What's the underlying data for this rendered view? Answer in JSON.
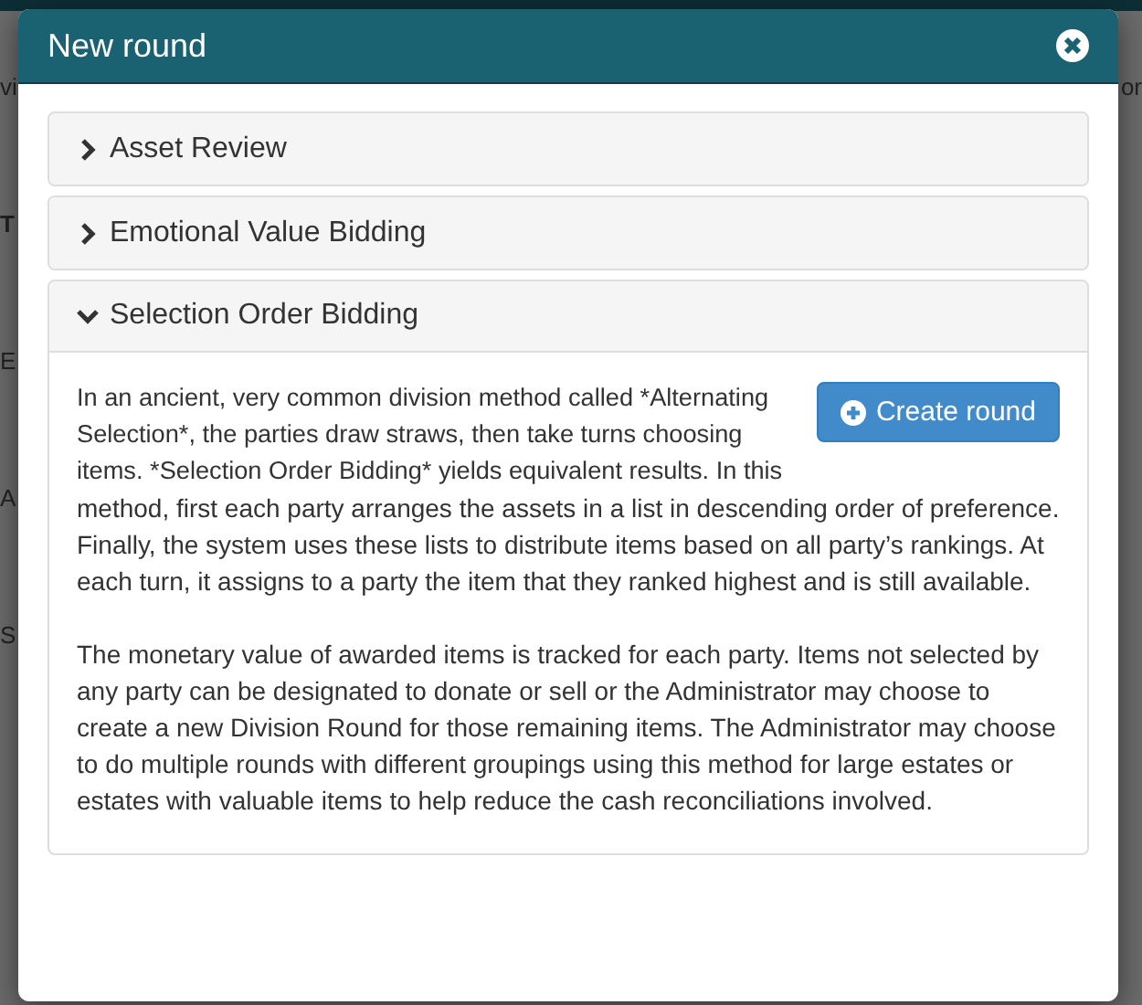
{
  "background": {
    "left_fragments": [
      {
        "text": "vi",
        "bold": false
      },
      {
        "text": "T",
        "bold": true
      },
      {
        "text": "E",
        "bold": false
      },
      {
        "text": "A",
        "bold": false
      },
      {
        "text": "S",
        "bold": false
      }
    ],
    "right_fragments": [
      {
        "text": "or",
        "bold": false
      }
    ]
  },
  "modal": {
    "title": "New round",
    "panels": [
      {
        "title": "Asset Review",
        "expanded": false
      },
      {
        "title": "Emotional Value Bidding",
        "expanded": false
      },
      {
        "title": "Selection Order Bidding",
        "expanded": true,
        "button": "Create round",
        "lead": "In an ancient, very common division method called *Alternating Selection*, the parties draw straws, then take turns choosing items. *Selection Order Bidding* yields equivalent results. In this",
        "paragraphs": [
          "method, first each party arranges the assets in a list in descending order of preference. Finally, the system uses these lists to distribute items based on all party’s rankings. At each turn, it assigns to a party the item that they ranked highest and is still available.",
          "The monetary value of awarded items is tracked for each party. Items not selected by any party can be designated to donate or sell or the Administrator may choose to create a new Division Round for those remaining items. The Administrator may choose to do multiple rounds with different groupings using this method for large estates or estates with valuable items to help reduce the cash reconciliations involved."
        ]
      }
    ]
  }
}
